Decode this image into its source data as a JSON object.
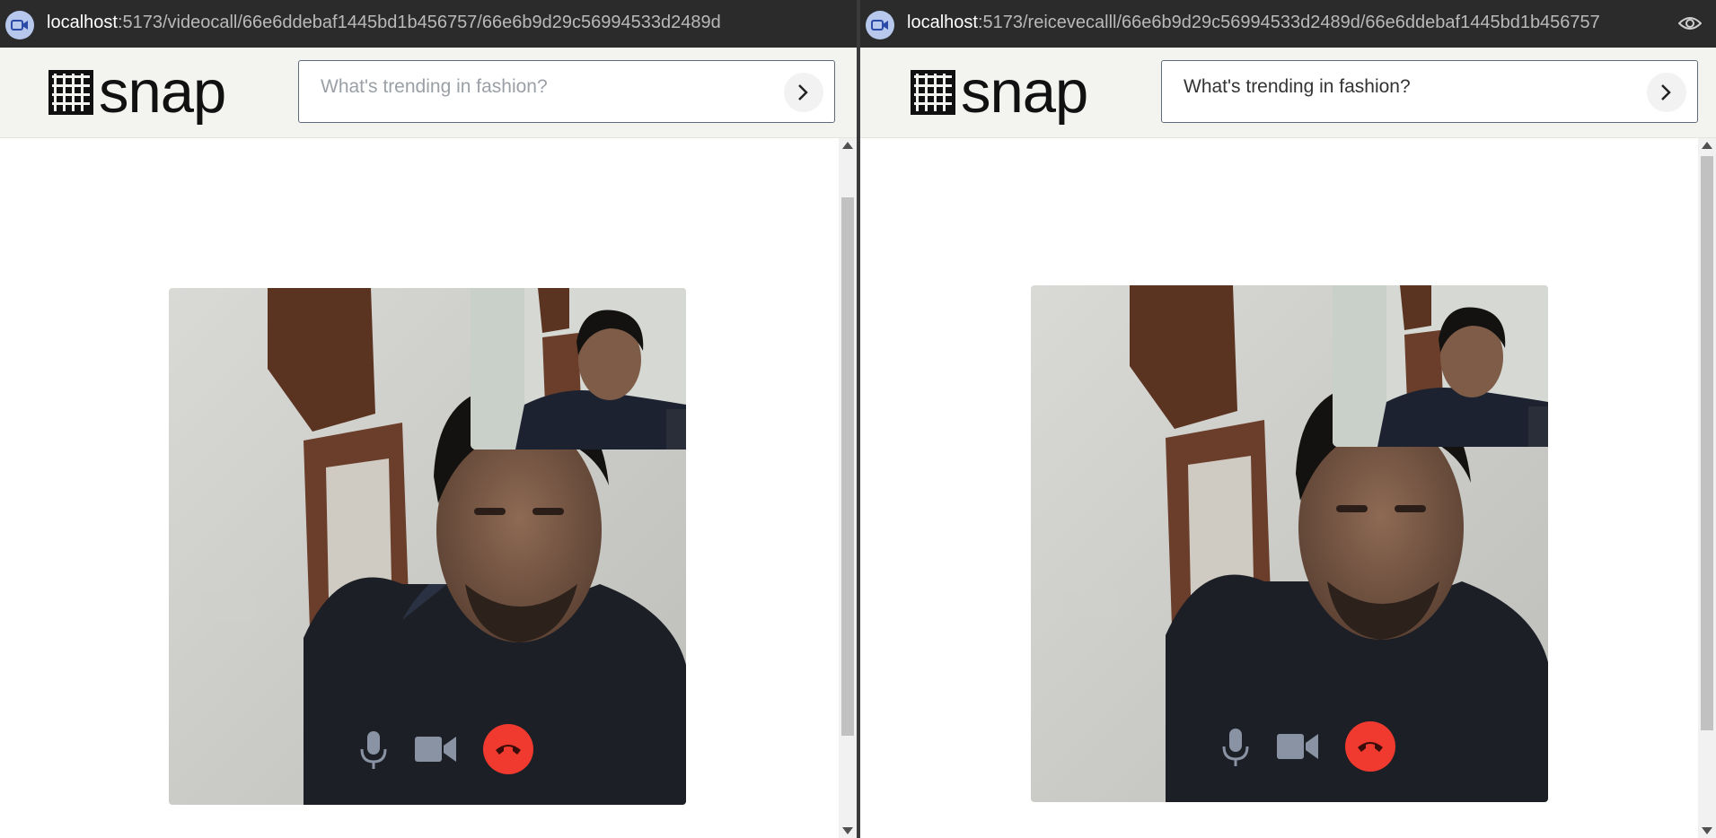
{
  "left": {
    "url_host": "localhost",
    "url_path": ":5173/videocall/66e6ddebaf1445bd1b456757/66e6b9d29c56994533d2489d",
    "brand": "snap",
    "search_placeholder": "What's trending in fashion?"
  },
  "right": {
    "url_host": "localhost",
    "url_path": ":5173/reicevecalll/66e6b9d29c56994533d2489d/66e6ddebaf1445bd1b456757",
    "brand": "snap",
    "search_placeholder": "What's trending in fashion?"
  },
  "colors": {
    "end_call": "#f03a2f",
    "url_bar": "#2b2b2b",
    "app_bar": "#f3f3ef",
    "control_icon": "#8a93a3"
  },
  "icons": [
    "video-call-icon",
    "eye-icon",
    "snap-logo-mark",
    "chevron-right-icon",
    "microphone-icon",
    "camera-icon",
    "end-call-icon"
  ]
}
